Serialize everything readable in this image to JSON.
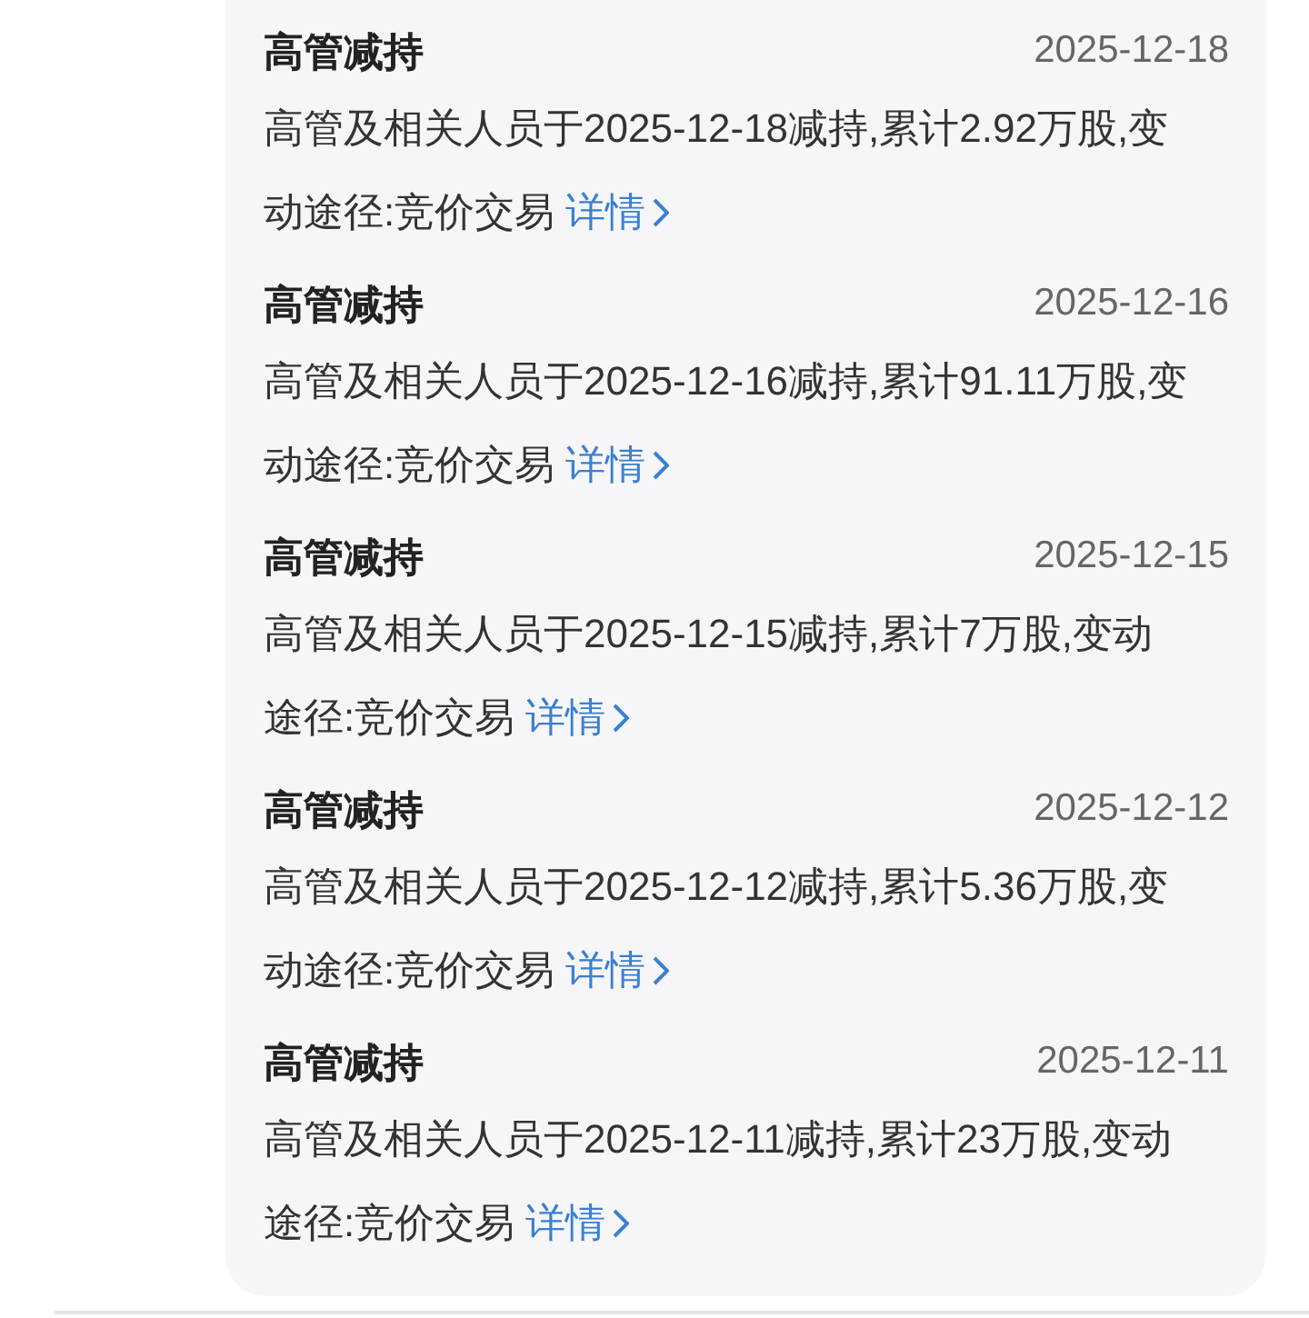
{
  "items": [
    {
      "title": "高管减持",
      "date": "2025-12-18",
      "text": "高管及相关人员于2025-12-18减持,累计2.92万股,变动途径:竞价交易",
      "link": "详情"
    },
    {
      "title": "高管减持",
      "date": "2025-12-16",
      "text": "高管及相关人员于2025-12-16减持,累计91.11万股,变动途径:竞价交易",
      "link": "详情"
    },
    {
      "title": "高管减持",
      "date": "2025-12-15",
      "text": "高管及相关人员于2025-12-15减持,累计7万股,变动途径:竞价交易",
      "link": "详情"
    },
    {
      "title": "高管减持",
      "date": "2025-12-12",
      "text": "高管及相关人员于2025-12-12减持,累计5.36万股,变动途径:竞价交易",
      "link": "详情"
    },
    {
      "title": "高管减持",
      "date": "2025-12-11",
      "text": "高管及相关人员于2025-12-11减持,累计23万股,变动途径:竞价交易",
      "link": "详情"
    }
  ]
}
